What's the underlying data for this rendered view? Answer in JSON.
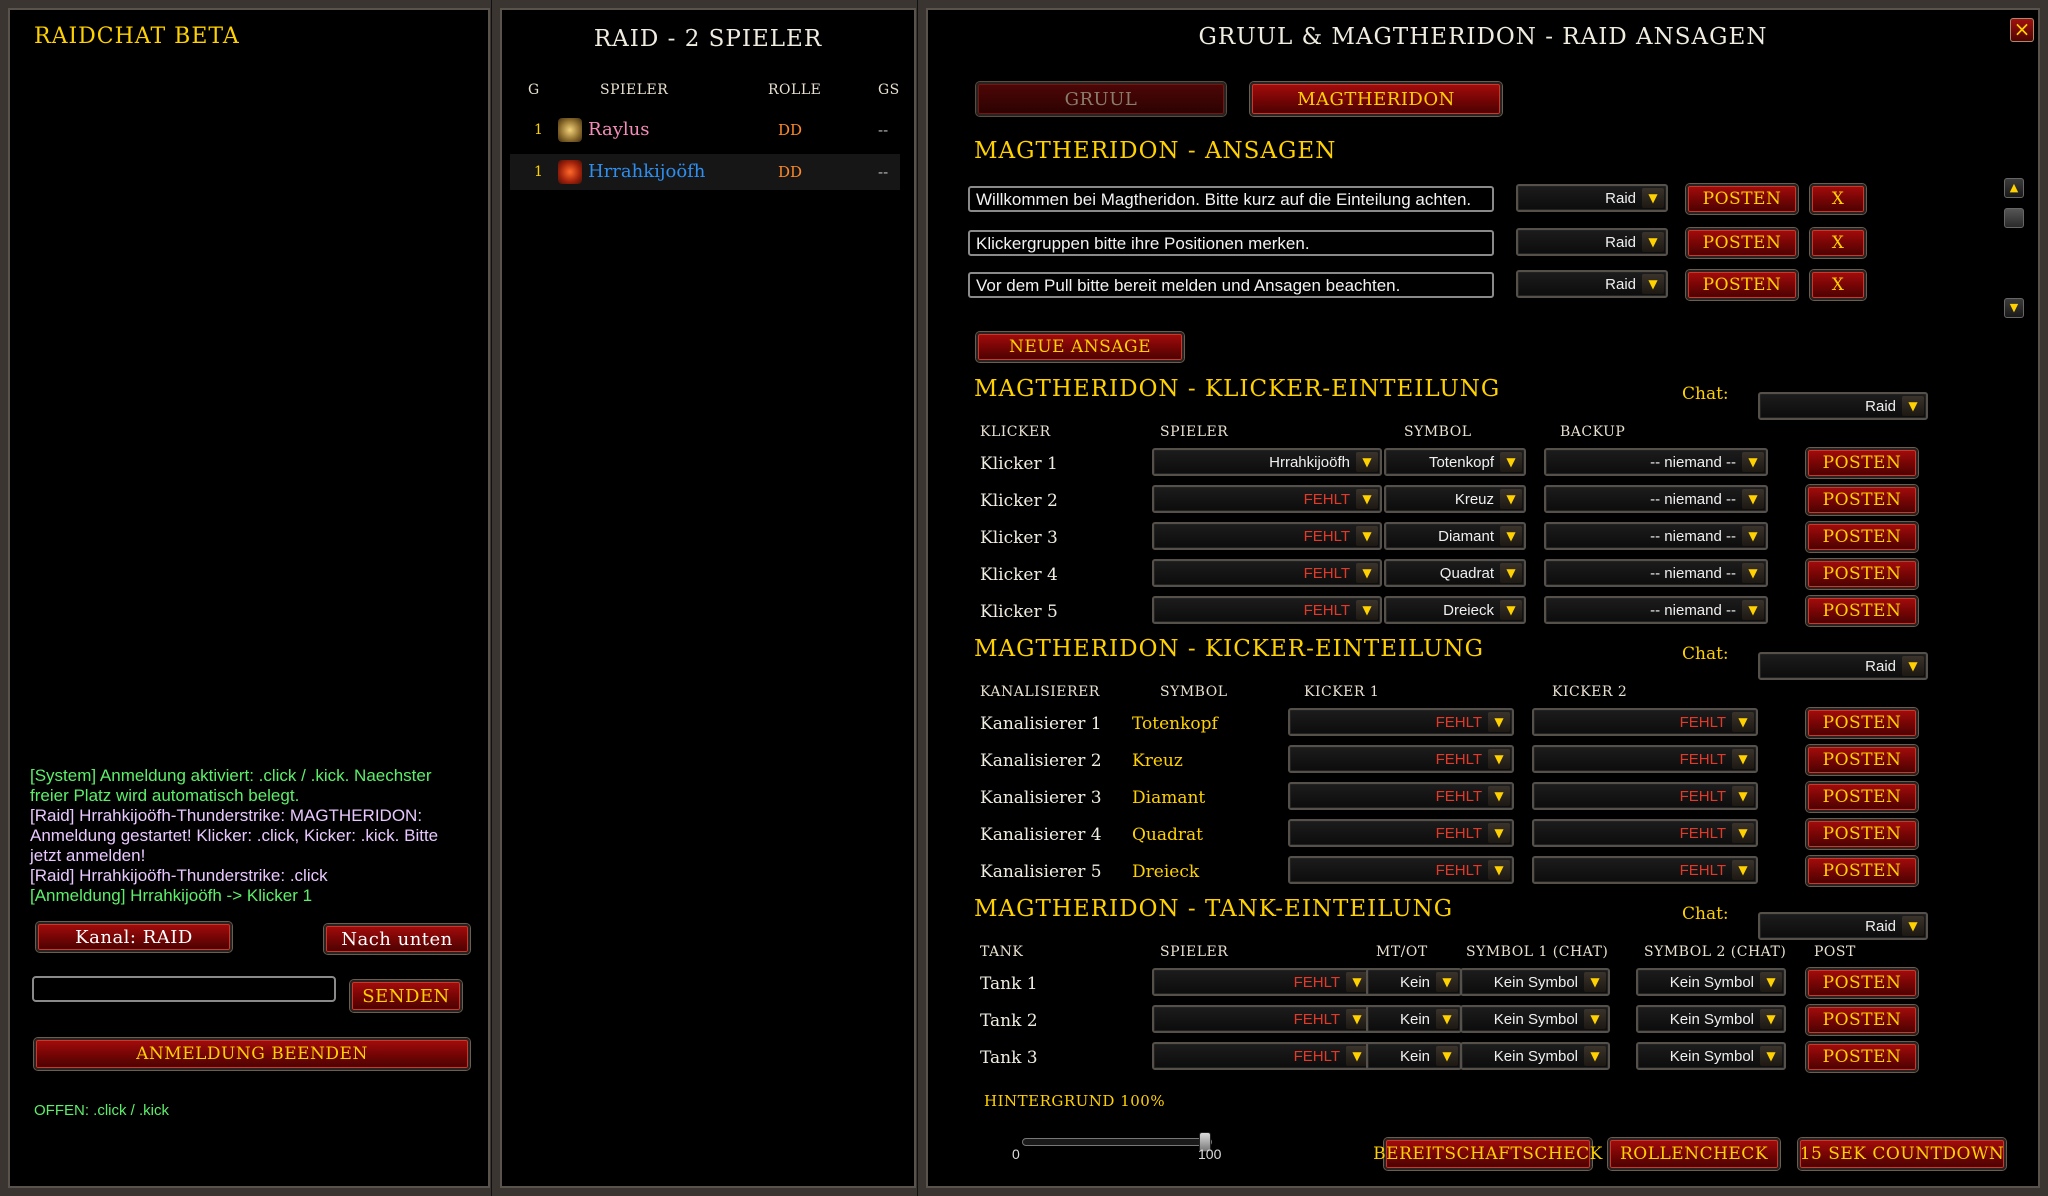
{
  "chat": {
    "title": "RAIDCHAT BETA",
    "messages": [
      {
        "type": "sys",
        "text": "[System] Anmeldung aktiviert: .click / .kick. Naechster freier Platz wird automatisch belegt."
      },
      {
        "type": "raid",
        "text": "[Raid] Hrrahkijoöfh-Thunderstrike: MAGTHERIDON: Anmeldung gestartet! Klicker: .click, Kicker: .kick. Bitte jetzt anmelden!"
      },
      {
        "type": "raid",
        "text": "[Raid] Hrrahkijoöfh-Thunderstrike: .click"
      },
      {
        "type": "anm",
        "text": "[Anmeldung] Hrrahkijoöfh -> Klicker 1"
      }
    ],
    "channel_button": "Kanal: RAID",
    "scroll_button": "Nach unten",
    "input_value": "",
    "send_button": "SENDEN",
    "end_signup_button": "ANMELDUNG BEENDEN",
    "status": "OFFEN: .click / .kick"
  },
  "raid": {
    "title": "RAID - 2 SPIELER",
    "headers": {
      "g": "G",
      "player": "SPIELER",
      "role": "ROLLE",
      "gs": "GS"
    },
    "rows": [
      {
        "g": "1",
        "name": "Raylus",
        "role": "DD",
        "gs": "--",
        "color": "#f58cba",
        "icon": "paladin-icon"
      },
      {
        "g": "1",
        "name": "Hrrahkijoöfh",
        "role": "DD",
        "gs": "--",
        "color": "#0070de",
        "icon": "shaman-icon"
      }
    ]
  },
  "main": {
    "title": "GRUUL & MAGTHERIDON - RAID ANSAGEN",
    "tabs": [
      {
        "label": "GRUUL",
        "active": false
      },
      {
        "label": "MAGTHERIDON",
        "active": true
      }
    ],
    "announcements": {
      "title": "MAGTHERIDON - ANSAGEN",
      "items": [
        {
          "text": "Willkommen bei Magtheridon. Bitte kurz auf die Einteilung achten.",
          "channel": "Raid"
        },
        {
          "text": "Klickergruppen bitte ihre Positionen merken.",
          "channel": "Raid"
        },
        {
          "text": "Vor dem Pull bitte bereit melden und Ansagen beachten.",
          "channel": "Raid"
        }
      ],
      "post_label": "POSTEN",
      "delete_label": "X",
      "new_button": "NEUE ANSAGE"
    },
    "clickers": {
      "title": "MAGTHERIDON - KLICKER-EINTEILUNG",
      "chat_label": "Chat:",
      "chat_value": "Raid",
      "headers": {
        "c1": "KLICKER",
        "c2": "SPIELER",
        "c3": "SYMBOL",
        "c4": "BACKUP"
      },
      "rows": [
        {
          "label": "Klicker 1",
          "player": "Hrrahkijoöfh",
          "symbol": "Totenkopf",
          "backup": "-- niemand --"
        },
        {
          "label": "Klicker 2",
          "player": "FEHLT",
          "symbol": "Kreuz",
          "backup": "-- niemand --"
        },
        {
          "label": "Klicker 3",
          "player": "FEHLT",
          "symbol": "Diamant",
          "backup": "-- niemand --"
        },
        {
          "label": "Klicker 4",
          "player": "FEHLT",
          "symbol": "Quadrat",
          "backup": "-- niemand --"
        },
        {
          "label": "Klicker 5",
          "player": "FEHLT",
          "symbol": "Dreieck",
          "backup": "-- niemand --"
        }
      ],
      "post_label": "POSTEN"
    },
    "kickers": {
      "title": "MAGTHERIDON - KICKER-EINTEILUNG",
      "chat_label": "Chat:",
      "chat_value": "Raid",
      "headers": {
        "c1": "KANALISIERER",
        "c2": "SYMBOL",
        "c3": "KICKER 1",
        "c4": "KICKER 2"
      },
      "rows": [
        {
          "label": "Kanalisierer 1",
          "symbol": "Totenkopf",
          "kicker1": "FEHLT",
          "kicker2": "FEHLT"
        },
        {
          "label": "Kanalisierer 2",
          "symbol": "Kreuz",
          "kicker1": "FEHLT",
          "kicker2": "FEHLT"
        },
        {
          "label": "Kanalisierer 3",
          "symbol": "Diamant",
          "kicker1": "FEHLT",
          "kicker2": "FEHLT"
        },
        {
          "label": "Kanalisierer 4",
          "symbol": "Quadrat",
          "kicker1": "FEHLT",
          "kicker2": "FEHLT"
        },
        {
          "label": "Kanalisierer 5",
          "symbol": "Dreieck",
          "kicker1": "FEHLT",
          "kicker2": "FEHLT"
        }
      ],
      "post_label": "POSTEN"
    },
    "tanks": {
      "title": "MAGTHERIDON - TANK-EINTEILUNG",
      "chat_label": "Chat:",
      "chat_value": "Raid",
      "headers": {
        "c1": "TANK",
        "c2": "SPIELER",
        "c3": "MT/OT",
        "c4": "SYMBOL 1 (CHAT)",
        "c5": "SYMBOL 2 (CHAT)",
        "c6": "POST"
      },
      "rows": [
        {
          "label": "Tank 1",
          "player": "FEHLT",
          "mtot": "Kein",
          "sym1": "Kein Symbol",
          "sym2": "Kein Symbol"
        },
        {
          "label": "Tank 2",
          "player": "FEHLT",
          "mtot": "Kein",
          "sym1": "Kein Symbol",
          "sym2": "Kein Symbol"
        },
        {
          "label": "Tank 3",
          "player": "FEHLT",
          "mtot": "Kein",
          "sym1": "Kein Symbol",
          "sym2": "Kein Symbol"
        }
      ],
      "post_label": "POSTEN"
    },
    "background": {
      "label": "HINTERGRUND 100%",
      "min": "0",
      "max": "100",
      "value": 100
    },
    "footer": {
      "ready_check": "BEREITSCHAFTSCHECK",
      "role_check": "ROLLENCHECK",
      "countdown": "15 SEK COUNTDOWN"
    },
    "close": "×"
  },
  "colors": {
    "gold": "#ffd100",
    "fehlt": "#e23a2a",
    "system_chat": "#5cf06a",
    "raid_chat": "#e8c8ff",
    "role_dd": "#ff8a2a"
  }
}
